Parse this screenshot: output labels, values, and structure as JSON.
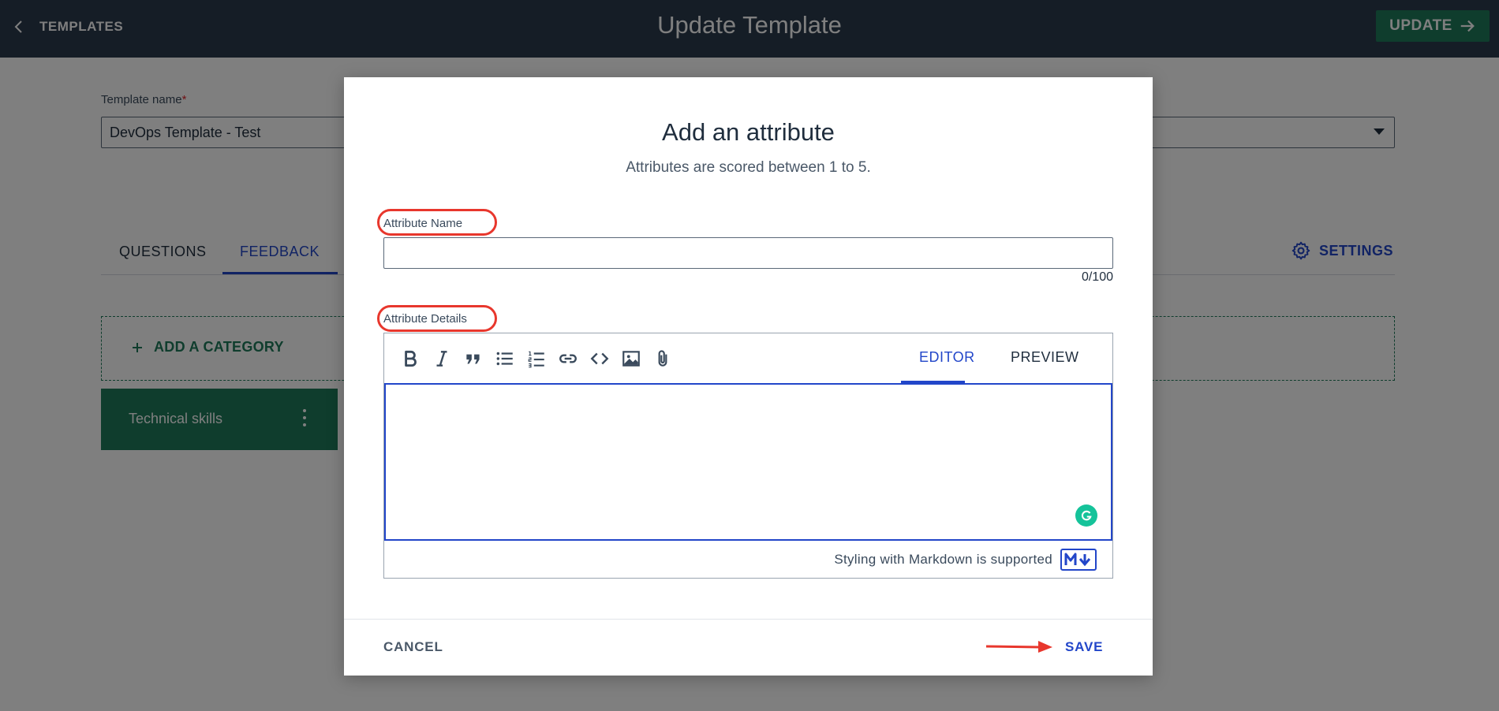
{
  "header": {
    "back_label": "TEMPLATES",
    "title": "Update Template",
    "update_label": "UPDATE"
  },
  "template_form": {
    "name_label": "Template name",
    "required_mark": "*",
    "name_value": "DevOps Template - Test"
  },
  "tabs": [
    {
      "label": "QUESTIONS"
    },
    {
      "label": "FEEDBACK"
    }
  ],
  "settings_label": "SETTINGS",
  "add_category_label": "ADD A CATEGORY",
  "categories": [
    {
      "label": "Technical skills"
    }
  ],
  "modal": {
    "title": "Add an attribute",
    "subtitle": "Attributes are scored between 1 to 5.",
    "attribute_name_label": "Attribute Name",
    "attribute_name_value": "",
    "char_counter": "0/100",
    "attribute_details_label": "Attribute Details",
    "editor_tabs": [
      "EDITOR",
      "PREVIEW"
    ],
    "toolbar_icons": [
      "bold-icon",
      "italic-icon",
      "quote-icon",
      "bulleted-list-icon",
      "numbered-list-icon",
      "link-icon",
      "code-icon",
      "image-icon",
      "attachment-icon"
    ],
    "markdown_note": "Styling with Markdown is supported",
    "cancel_label": "CANCEL",
    "save_label": "SAVE"
  },
  "colors": {
    "topbar": "#2a3a4d",
    "brand_green": "#1f7a5a",
    "accent_blue": "#2246c9",
    "highlight_red": "#e8372d"
  }
}
